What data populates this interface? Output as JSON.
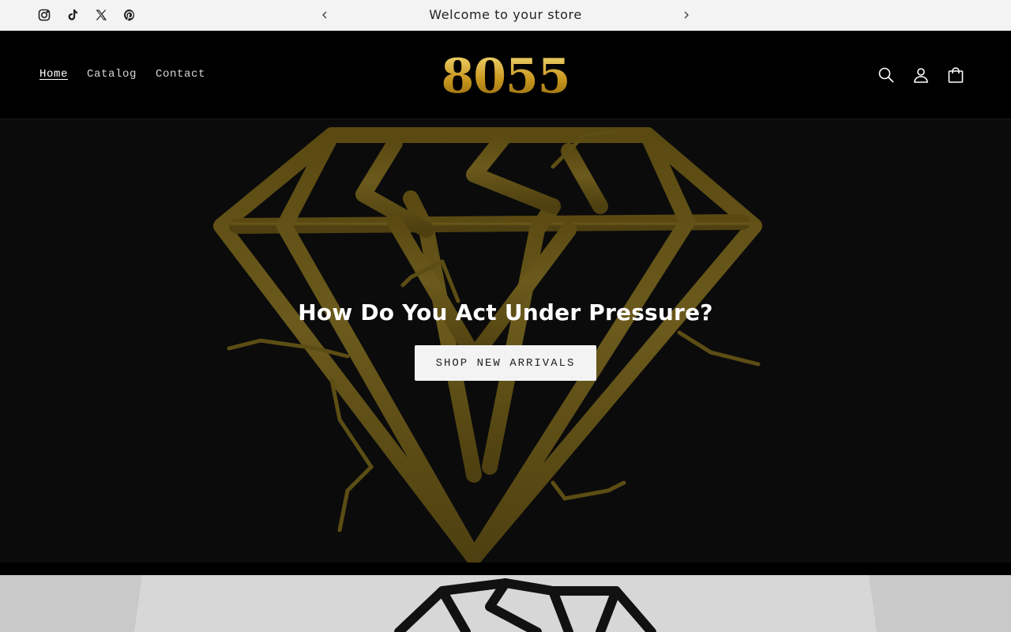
{
  "announcement": {
    "text": "Welcome to your store",
    "socials": [
      "instagram-icon",
      "tiktok-icon",
      "x-icon",
      "pinterest-icon"
    ]
  },
  "header": {
    "logo": "8055",
    "nav": [
      {
        "label": "Home",
        "active": true
      },
      {
        "label": "Catalog",
        "active": false
      },
      {
        "label": "Contact",
        "active": false
      }
    ],
    "icons": [
      "search-icon",
      "account-icon",
      "cart-icon"
    ]
  },
  "hero": {
    "title": "How Do You Act Under Pressure?",
    "button_label": "SHOP NEW ARRIVALS"
  },
  "colors": {
    "accent_gold": "#d6ad3b",
    "hero_art": "#5c4d14",
    "background": "#000000"
  }
}
